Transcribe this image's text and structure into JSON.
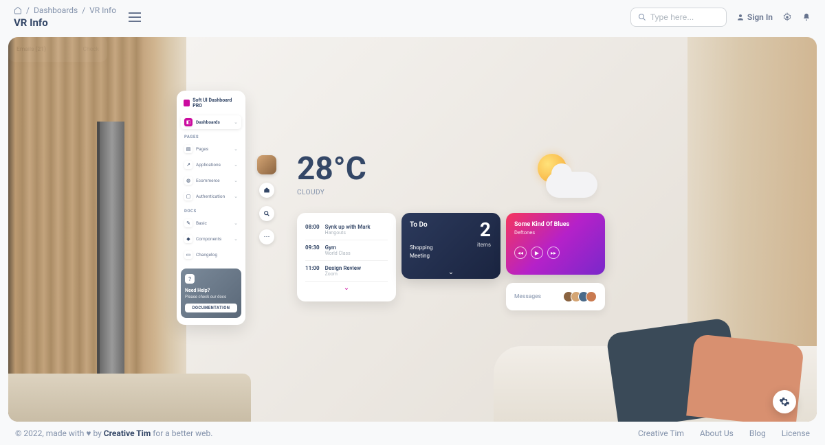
{
  "breadcrumb": {
    "parent": "Dashboards",
    "current": "VR Info"
  },
  "page_title": "VR Info",
  "search": {
    "placeholder": "Type here..."
  },
  "signin": "Sign In",
  "sidebar": {
    "brand": "Soft UI Dashboard PRO",
    "dashboards": "Dashboards",
    "section_pages": "PAGES",
    "pages": "Pages",
    "applications": "Applications",
    "ecommerce": "Ecommerce",
    "authentication": "Authentication",
    "section_docs": "DOCS",
    "basic": "Basic",
    "components": "Components",
    "changelog": "Changelog",
    "help_title": "Need Help?",
    "help_sub": "Please check our docs",
    "help_btn": "DOCUMENTATION"
  },
  "weather": {
    "temp": "28°C",
    "condition": "CLOUDY"
  },
  "schedule": [
    {
      "time": "08:00",
      "title": "Synk up with Mark",
      "sub": "Hangouts"
    },
    {
      "time": "09:30",
      "title": "Gym",
      "sub": "World Class"
    },
    {
      "time": "11:00",
      "title": "Design Review",
      "sub": "Zoom"
    }
  ],
  "todo": {
    "title": "To Do",
    "count": "2",
    "items_label": "items",
    "line1": "Shopping",
    "line2": "Meeting"
  },
  "emails": {
    "label": "Emails (21)",
    "action": "Check"
  },
  "player": {
    "song": "Some Kind Of Blues",
    "artist": "Deftones"
  },
  "messages": {
    "label": "Messages"
  },
  "footer": {
    "copyright_pre": "© 2022, made with",
    "copyright_mid": "by",
    "brand": "Creative Tim",
    "copyright_post": "for a better web.",
    "links": {
      "creative": "Creative Tim",
      "about": "About Us",
      "blog": "Blog",
      "license": "License"
    }
  }
}
